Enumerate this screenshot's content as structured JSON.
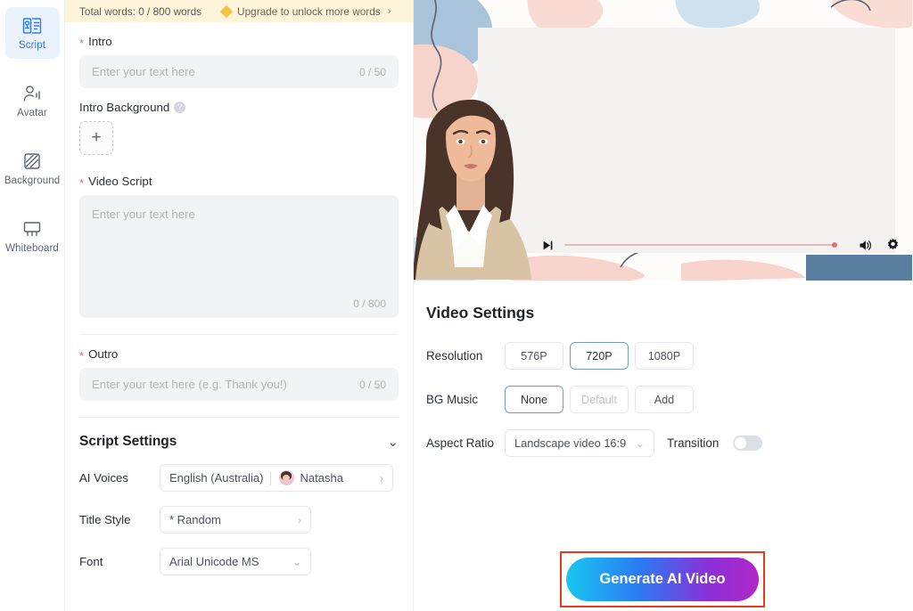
{
  "sidebar": {
    "items": [
      {
        "label": "Script",
        "icon": "script-icon",
        "active": true
      },
      {
        "label": "Avatar",
        "icon": "avatar-icon",
        "active": false
      },
      {
        "label": "Background",
        "icon": "background-icon",
        "active": false
      },
      {
        "label": "Whiteboard",
        "icon": "whiteboard-icon",
        "active": false
      }
    ]
  },
  "banner": {
    "words_text": "Total words: 0 / 800 words",
    "upgrade_text": "Upgrade to unlock more words",
    "chevron": "›",
    "icon": "diamond-icon",
    "bg_color": "#fdf4d9"
  },
  "script": {
    "intro": {
      "label": "Intro",
      "required_mark": "*",
      "placeholder": "Enter your text here",
      "value": "",
      "counter": "0 / 50"
    },
    "intro_background": {
      "label": "Intro Background",
      "help_glyph": "?",
      "add_glyph": "+"
    },
    "video_script": {
      "label": "Video Script",
      "required_mark": "*",
      "placeholder": "Enter your text here",
      "value": "",
      "counter": "0 / 800"
    },
    "outro": {
      "label": "Outro",
      "required_mark": "*",
      "placeholder": "Enter your text here (e.g. Thank you!)",
      "value": "",
      "counter": "0 / 50"
    },
    "settings": {
      "title": "Script Settings",
      "collapse_glyph": "⌄",
      "rows": [
        {
          "label": "AI Voices",
          "language": "English (Australia)",
          "voice": "Natasha",
          "chevron": "›"
        },
        {
          "label": "Title Style",
          "value": "* Random",
          "chevron": "›"
        },
        {
          "label": "Font",
          "value": "Arial Unicode MS",
          "chevron": "⌄"
        }
      ]
    }
  },
  "preview": {
    "player": {
      "skip_icon": "skip-next-icon",
      "volume_icon": "volume-icon",
      "settings_icon": "gear-icon",
      "progress_percent": 100
    },
    "colors": {
      "blob_blue": "#a9c3db",
      "blob_pink": "#f7d4cb",
      "blob_lightblue": "#cfe0ef",
      "canvas": "#f3f2f0",
      "progress": "#e9b7b7"
    }
  },
  "video_settings": {
    "title": "Video Settings",
    "resolution": {
      "label": "Resolution",
      "options": [
        "576P",
        "720P",
        "1080P"
      ],
      "selected": "720P"
    },
    "bg_music": {
      "label": "BG Music",
      "options": [
        "None",
        "Default",
        "Add"
      ],
      "selected": "None",
      "disabled": [
        "Default"
      ]
    },
    "aspect_ratio": {
      "label": "Aspect Ratio",
      "value": "Landscape video 16:9",
      "caret": "⌄"
    },
    "transition": {
      "label": "Transition",
      "enabled": false
    },
    "accent_color": "#6f9fb5"
  },
  "generate": {
    "label": "Generate AI Video",
    "highlight_color": "#e8391b",
    "gradient_from": "#18c6f0",
    "gradient_to": "#b228c6"
  },
  "annotation": {
    "arrow_color": "#f63a0f",
    "arrow_name": "red-pointer-arrow"
  }
}
